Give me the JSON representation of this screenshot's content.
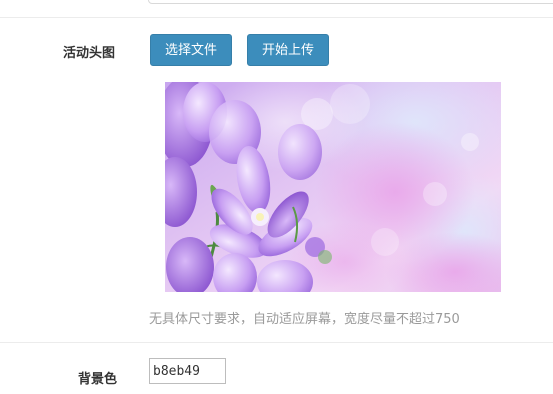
{
  "form": {
    "avatar": {
      "label": "活动头图",
      "choose_file_label": "选择文件",
      "start_upload_label": "开始上传",
      "hint": "无具体尺寸要求，自动适应屏幕，宽度尽量不超过750"
    },
    "background": {
      "label": "背景色",
      "value": "b8eb49"
    }
  },
  "colors": {
    "button": "#3c8dbc",
    "divider": "#ececec",
    "hint_text": "#9a9a9a"
  }
}
